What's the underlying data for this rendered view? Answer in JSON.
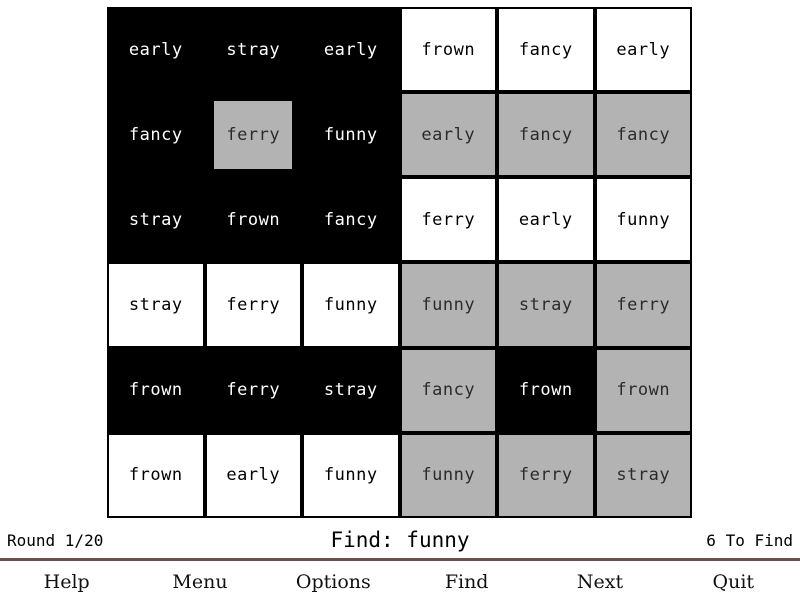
{
  "grid": {
    "rows": 6,
    "cols": 6,
    "colors": {
      "white": "#ffffff",
      "gray": "#b3b3b3",
      "black": "#000000"
    },
    "cells": [
      {
        "word": "early",
        "state": "black"
      },
      {
        "word": "stray",
        "state": "black"
      },
      {
        "word": "early",
        "state": "black"
      },
      {
        "word": "frown",
        "state": "white"
      },
      {
        "word": "fancy",
        "state": "white"
      },
      {
        "word": "early",
        "state": "white"
      },
      {
        "word": "fancy",
        "state": "black"
      },
      {
        "word": "ferry",
        "state": "gray-inset"
      },
      {
        "word": "funny",
        "state": "black"
      },
      {
        "word": "early",
        "state": "gray"
      },
      {
        "word": "fancy",
        "state": "gray"
      },
      {
        "word": "fancy",
        "state": "gray"
      },
      {
        "word": "stray",
        "state": "black"
      },
      {
        "word": "frown",
        "state": "black"
      },
      {
        "word": "fancy",
        "state": "black"
      },
      {
        "word": "ferry",
        "state": "white"
      },
      {
        "word": "early",
        "state": "white"
      },
      {
        "word": "funny",
        "state": "white"
      },
      {
        "word": "stray",
        "state": "white"
      },
      {
        "word": "ferry",
        "state": "white"
      },
      {
        "word": "funny",
        "state": "white"
      },
      {
        "word": "funny",
        "state": "gray"
      },
      {
        "word": "stray",
        "state": "gray"
      },
      {
        "word": "ferry",
        "state": "gray"
      },
      {
        "word": "frown",
        "state": "black"
      },
      {
        "word": "ferry",
        "state": "black"
      },
      {
        "word": "stray",
        "state": "black"
      },
      {
        "word": "fancy",
        "state": "gray"
      },
      {
        "word": "frown",
        "state": "black-inset"
      },
      {
        "word": "frown",
        "state": "gray"
      },
      {
        "word": "frown",
        "state": "white"
      },
      {
        "word": "early",
        "state": "white"
      },
      {
        "word": "funny",
        "state": "white"
      },
      {
        "word": "funny",
        "state": "gray"
      },
      {
        "word": "ferry",
        "state": "gray"
      },
      {
        "word": "stray",
        "state": "gray"
      }
    ]
  },
  "status": {
    "round": "Round 1/20",
    "find": "Find: funny",
    "remaining": "6 To Find"
  },
  "menu": {
    "items": [
      {
        "label": "Help",
        "name": "menu-item-help"
      },
      {
        "label": "Menu",
        "name": "menu-item-menu"
      },
      {
        "label": "Options",
        "name": "menu-item-options"
      },
      {
        "label": "Find",
        "name": "menu-item-find"
      },
      {
        "label": "Next",
        "name": "menu-item-next"
      },
      {
        "label": "Quit",
        "name": "menu-item-quit"
      }
    ]
  },
  "theme": {
    "divider_color": "#6b5050",
    "background": "#ffffff"
  }
}
